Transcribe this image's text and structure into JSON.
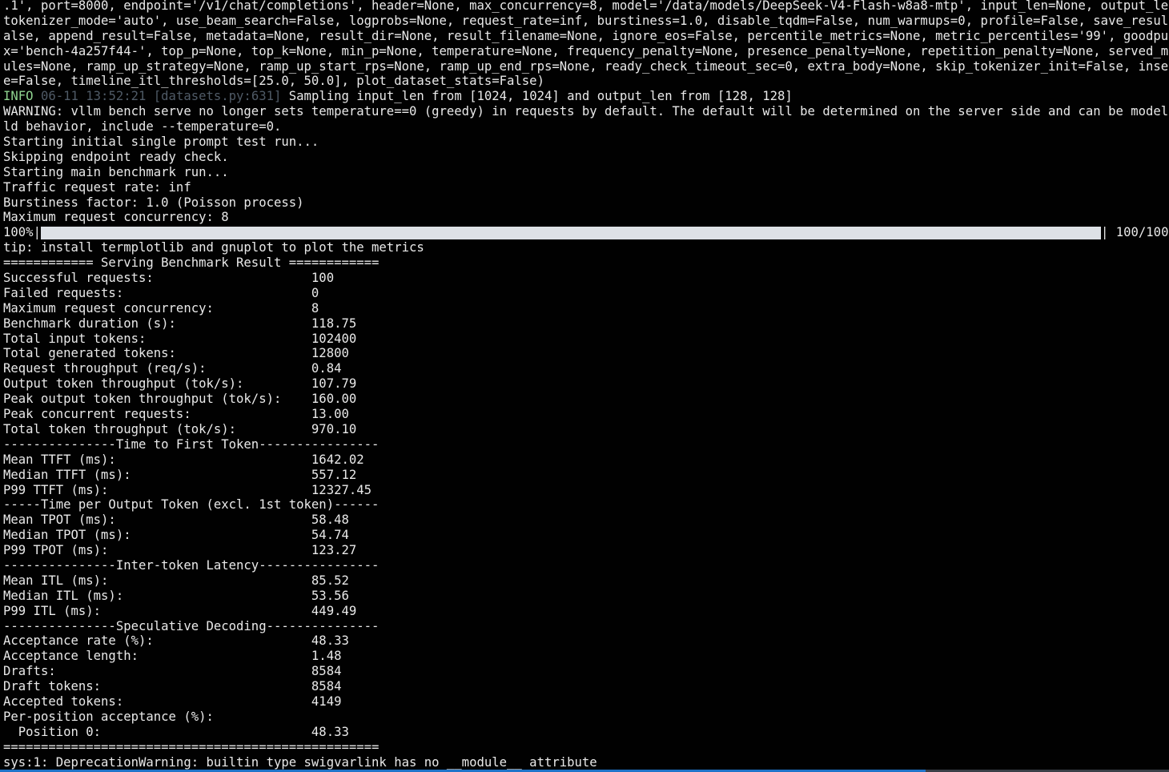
{
  "terminal": {
    "args_lines": [
      ".1', port=8000, endpoint='/v1/chat/completions', header=None, max_concurrency=8, model='/data/models/DeepSeek-V4-Flash-w8a8-mtp', input_len=None, output_len",
      "tokenizer_mode='auto', use_beam_search=False, logprobs=None, request_rate=inf, burstiness=1.0, disable_tqdm=False, num_warmups=0, profile=False, save_result",
      "alse, append_result=False, metadata=None, result_dir=None, result_filename=None, ignore_eos=False, percentile_metrics=None, metric_percentiles='99', goodput",
      "x='bench-4a257f44-', top_p=None, top_k=None, min_p=None, temperature=None, frequency_penalty=None, presence_penalty=None, repetition_penalty=None, served_m",
      "ules=None, ramp_up_strategy=None, ramp_up_start_rps=None, ramp_up_end_rps=None, ready_check_timeout_sec=0, extra_body=None, skip_tokenizer_init=False, insec",
      "e=False, timeline_itl_thresholds=[25.0, 50.0], plot_dataset_stats=False)"
    ],
    "info_line": {
      "level": "INFO",
      "meta": "06-11 13:52:21 [datasets.py:631]",
      "message": "Sampling input_len from [1024, 1024] and output_len from [128, 128]"
    },
    "status_lines": [
      "WARNING: vllm bench serve no longer sets temperature==0 (greedy) in requests by default. The default will be determined on the server side and can be model",
      "ld behavior, include --temperature=0.",
      "Starting initial single prompt test run...",
      "Skipping endpoint ready check.",
      "Starting main benchmark run...",
      "Traffic request rate: inf",
      "Burstiness factor: 1.0 (Poisson process)",
      "Maximum request concurrency: 8"
    ],
    "progress": {
      "percent_label": "100%",
      "fraction": 1.0,
      "count_label": "100/100"
    },
    "result_lines": [
      "tip: install termplotlib and gnuplot to plot the metrics",
      "============ Serving Benchmark Result ============",
      "Successful requests:                     100",
      "Failed requests:                         0",
      "Maximum request concurrency:             8",
      "Benchmark duration (s):                  118.75",
      "Total input tokens:                      102400",
      "Total generated tokens:                  12800",
      "Request throughput (req/s):              0.84",
      "Output token throughput (tok/s):         107.79",
      "Peak output token throughput (tok/s):    160.00",
      "Peak concurrent requests:                13.00",
      "Total token throughput (tok/s):          970.10",
      "---------------Time to First Token----------------",
      "Mean TTFT (ms):                          1642.02",
      "Median TTFT (ms):                        557.12",
      "P99 TTFT (ms):                           12327.45",
      "-----Time per Output Token (excl. 1st token)------",
      "Mean TPOT (ms):                          58.48",
      "Median TPOT (ms):                        54.74",
      "P99 TPOT (ms):                           123.27",
      "---------------Inter-token Latency----------------",
      "Mean ITL (ms):                           85.52",
      "Median ITL (ms):                         53.56",
      "P99 ITL (ms):                            449.49",
      "---------------Speculative Decoding---------------",
      "Acceptance rate (%):                     48.33",
      "Acceptance length:                       1.48",
      "Drafts:                                  8584",
      "Draft tokens:                            8584",
      "Accepted tokens:                         4149",
      "Per-position acceptance (%):",
      "  Position 0:                            48.33",
      "==================================================",
      "sys:1: DeprecationWarning: builtin type swigvarlink has no __module__ attribute"
    ]
  },
  "colors": {
    "background": "#010101",
    "text": "#e9e9e9",
    "info": "#8fd38f",
    "info_meta": "#4f5a66",
    "progress_fill": "#dde1e6",
    "accent_strip": "#1f74c9"
  }
}
